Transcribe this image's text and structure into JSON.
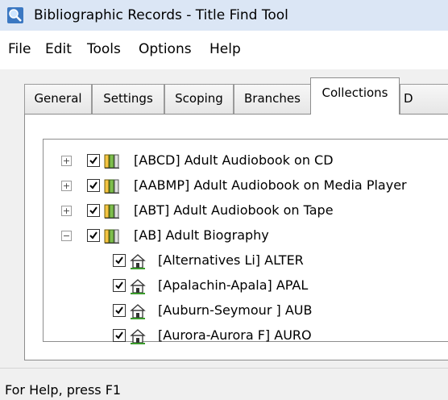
{
  "window": {
    "title": "Bibliographic Records - Title Find Tool",
    "app_icon": "search-records-icon"
  },
  "menu": {
    "items": [
      "File",
      "Edit",
      "Tools",
      "Options",
      "Help"
    ]
  },
  "tabs": [
    {
      "label": "General"
    },
    {
      "label": "Settings"
    },
    {
      "label": "Scoping"
    },
    {
      "label": "Branches"
    },
    {
      "label": "Collections",
      "active": true
    },
    {
      "label": "D"
    }
  ],
  "tree": {
    "collections": [
      {
        "label": "[ABCD] Adult Audiobook on CD",
        "expanded": false,
        "checked": true,
        "icon": "collection-books-icon"
      },
      {
        "label": "[AABMP] Adult Audiobook on Media Player",
        "expanded": false,
        "checked": true,
        "icon": "collection-books-icon"
      },
      {
        "label": "[ABT] Adult Audiobook on Tape",
        "expanded": false,
        "checked": true,
        "icon": "collection-books-icon"
      },
      {
        "label": "[AB] Adult Biography",
        "expanded": true,
        "checked": true,
        "icon": "collection-books-icon",
        "branches": [
          {
            "label": "[Alternatives Li] ALTER",
            "checked": true,
            "icon": "library-branch-icon"
          },
          {
            "label": "[Apalachin-Apala] APAL",
            "checked": true,
            "icon": "library-branch-icon"
          },
          {
            "label": "[Auburn-Seymour ] AUB",
            "checked": true,
            "icon": "library-branch-icon"
          },
          {
            "label": "[Aurora-Aurora F] AURO",
            "checked": true,
            "icon": "library-branch-icon"
          }
        ]
      }
    ]
  },
  "statusbar": {
    "text": "For Help, press F1"
  },
  "colors": {
    "titlebar": "#dbe6f5",
    "dialog_bg": "#f0f0f0",
    "panel_bg": "#ffffff"
  }
}
